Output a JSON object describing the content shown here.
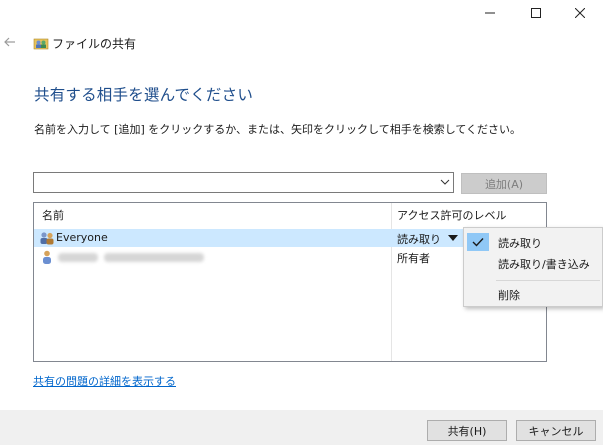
{
  "window": {
    "title": "ファイルの共有",
    "controls": {
      "minimize": "minimize",
      "maximize": "maximize",
      "close": "close"
    }
  },
  "heading": "共有する相手を選んでください",
  "instruction": "名前を入力して [追加] をクリックするか、または、矢印をクリックして相手を検索してください。",
  "combo": {
    "value": "",
    "placeholder": ""
  },
  "add_button": "追加(A)",
  "list": {
    "columns": {
      "name": "名前",
      "level": "アクセス許可のレベル"
    },
    "rows": [
      {
        "name": "Everyone",
        "level": "読み取り",
        "selected": true,
        "icon": "group-users-icon"
      },
      {
        "name": "",
        "level": "所有者",
        "selected": false,
        "icon": "user-icon"
      }
    ]
  },
  "menu": {
    "items": [
      {
        "label": "読み取り",
        "checked": true
      },
      {
        "label": "読み取り/書き込み",
        "checked": false
      },
      {
        "label": "削除",
        "checked": false
      }
    ]
  },
  "link": "共有の問題の詳細を表示する",
  "buttons": {
    "share": "共有(H)",
    "cancel": "キャンセル"
  },
  "colors": {
    "heading": "#1f4e8c",
    "link": "#0066cc",
    "selection": "#cce8ff",
    "check_highlight": "#90c8f6"
  }
}
